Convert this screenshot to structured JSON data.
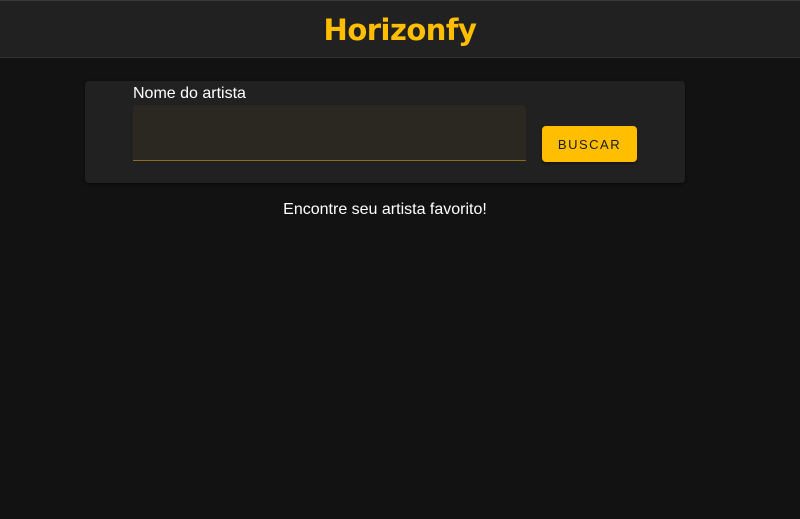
{
  "app": {
    "title": "Horizonfy",
    "accent_color": "#ffbf00",
    "background_color": "#121212"
  },
  "search": {
    "label": "Nome do artista",
    "value": "",
    "button_label": "BUSCAR"
  },
  "main": {
    "hint": "Encontre seu artista favorito!"
  }
}
